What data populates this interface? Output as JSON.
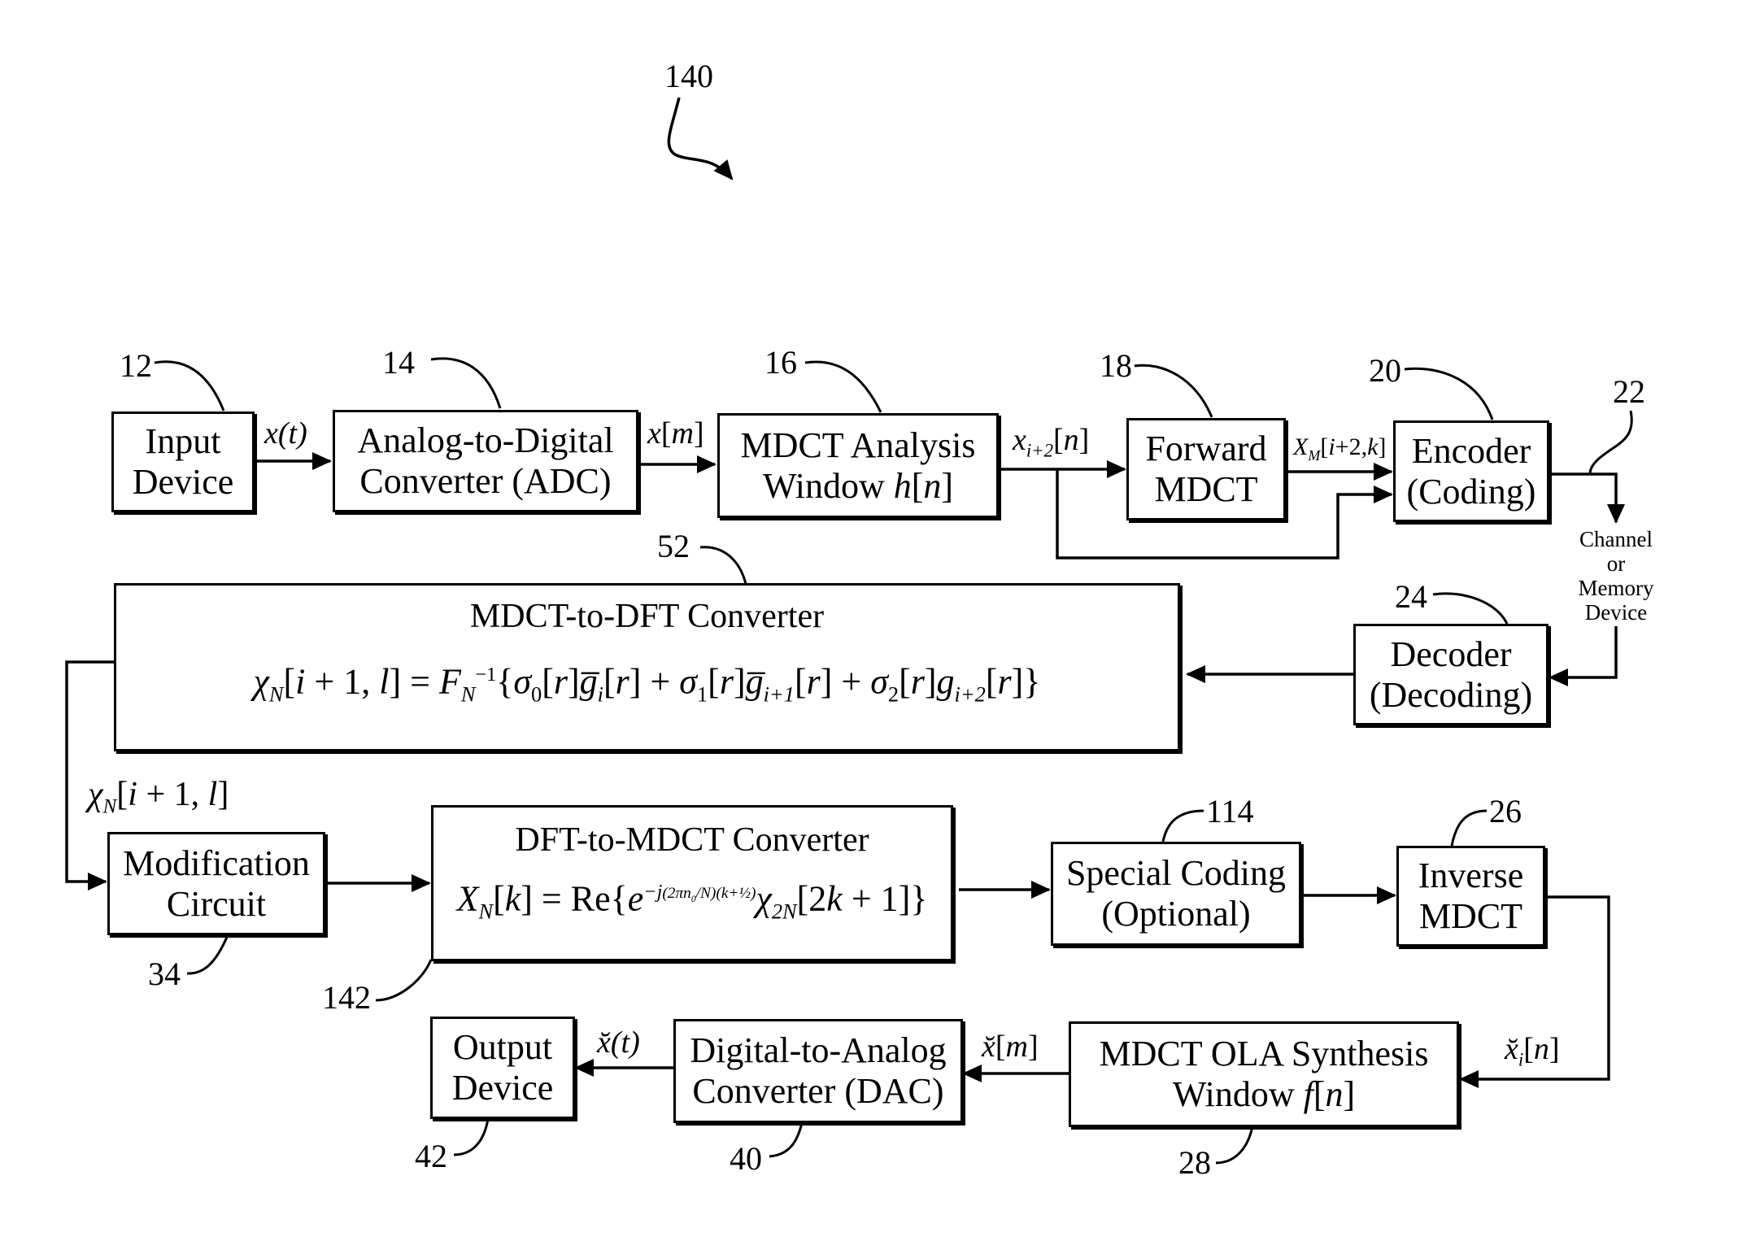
{
  "figure": {
    "ref": "140"
  },
  "blocks": {
    "input_device": {
      "ref": "12",
      "line1": "Input",
      "line2": "Device"
    },
    "adc": {
      "ref": "14",
      "line1": "Analog-to-Digital",
      "line2": "Converter (ADC)"
    },
    "analysis_window": {
      "ref": "16",
      "line1": "MDCT Analysis",
      "line2": "Window h[n]"
    },
    "forward_mdct": {
      "ref": "18",
      "line1": "Forward",
      "line2": "MDCT"
    },
    "encoder": {
      "ref": "20",
      "line1": "Encoder",
      "line2": "(Coding)"
    },
    "channel": {
      "ref": "22",
      "lines": [
        "Channel",
        "or",
        "Memory",
        "Device"
      ]
    },
    "decoder": {
      "ref": "24",
      "line1": "Decoder",
      "line2": "(Decoding)"
    },
    "mdct_to_dft": {
      "ref": "52",
      "title": "MDCT-to-DFT Converter",
      "formula": "χN[i+1,l] = FN^-1{σ0[r]ḡ̄i[r] + σ1[r]ḡi+1[r] + σ2[r]gi+2[r]}"
    },
    "modification": {
      "ref": "34",
      "line1": "Modification",
      "line2": "Circuit"
    },
    "dft_to_mdct": {
      "ref": "142",
      "title": "DFT-to-MDCT Converter",
      "formula": "XN[k] = Re{e^(-j(2πn0/N)(k+1/2)) χ2N[2k+1]}"
    },
    "special_coding": {
      "ref": "114",
      "line1": "Special Coding",
      "line2": "(Optional)"
    },
    "inverse_mdct": {
      "ref": "26",
      "line1": "Inverse",
      "line2": "MDCT"
    },
    "synthesis_window": {
      "ref": "28",
      "line1": "MDCT OLA Synthesis",
      "line2": "Window f[n]"
    },
    "dac": {
      "ref": "40",
      "line1": "Digital-to-Analog",
      "line2": "Converter (DAC)"
    },
    "output_device": {
      "ref": "42",
      "line1": "Output",
      "line2": "Device"
    }
  },
  "signals": {
    "x_t": "x(t)",
    "x_m": "x[m]",
    "x_i2_n": "x_{i+2}[n]",
    "X_M": "X_M[i+2,k]",
    "chi_N": "χ_N[i+1,l]",
    "xbreve_i_n": "x̆_i[n]",
    "xbreve_m": "x̆[m]",
    "xbreve_t": "x̆(t)"
  }
}
